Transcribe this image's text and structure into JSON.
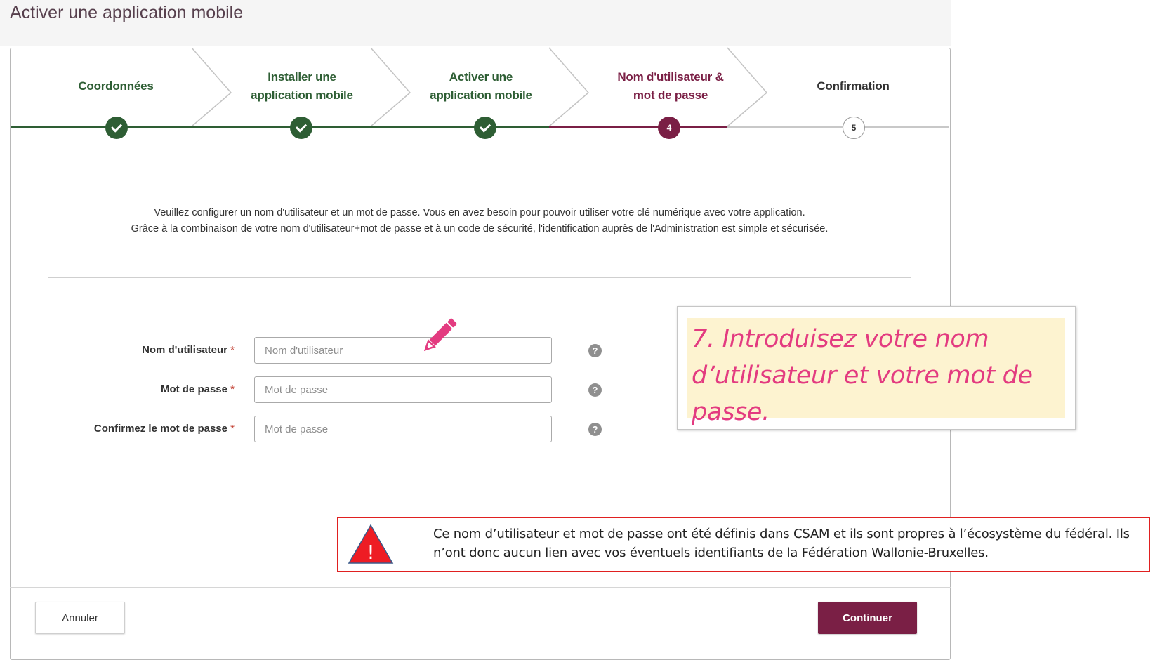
{
  "header": {
    "title": "Activer une application mobile"
  },
  "stepper": {
    "steps": [
      {
        "label_line1": "Coordonnées",
        "label_line2": "",
        "state": "done",
        "number": ""
      },
      {
        "label_line1": "Installer une",
        "label_line2": "application mobile",
        "state": "done",
        "number": ""
      },
      {
        "label_line1": "Activer une",
        "label_line2": "application mobile",
        "state": "done",
        "number": ""
      },
      {
        "label_line1": "Nom d'utilisateur &",
        "label_line2": "mot de passe",
        "state": "active",
        "number": "4"
      },
      {
        "label_line1": "Confirmation",
        "label_line2": "",
        "state": "todo",
        "number": "5"
      }
    ]
  },
  "intro": {
    "line1": "Veuillez configurer un nom d'utilisateur et un mot de passe. Vous en avez besoin pour pouvoir utiliser votre clé numérique avec votre application.",
    "line2": "Grâce à la combinaison de votre nom d'utilisateur+mot de passe et à un code de sécurité, l'identification auprès de l'Administration est simple et sécurisée."
  },
  "form": {
    "required_mark": "*",
    "help_symbol": "?",
    "fields": [
      {
        "label": "Nom d'utilisateur",
        "placeholder": "Nom d'utilisateur",
        "value": ""
      },
      {
        "label": "Mot de passe",
        "placeholder": "Mot de passe",
        "value": ""
      },
      {
        "label": "Confirmez le mot de passe",
        "placeholder": "Mot de passe",
        "value": ""
      }
    ]
  },
  "callout": {
    "text": "7. Introduisez votre nom d’utilisateur et votre mot de passe."
  },
  "warning": {
    "symbol": "!",
    "text": "Ce nom d’utilisateur et mot de passe ont été définis dans CSAM et ils sont propres à l’écosystème du fédéral. Ils n’ont donc aucun lien avec vos éventuels identifiants de la Fédération Wallonie-Bruxelles."
  },
  "footer": {
    "cancel_label": "Annuler",
    "continue_label": "Continuer"
  },
  "colors": {
    "done": "#2e5e34",
    "active": "#7a1f45",
    "todo_border": "#999999",
    "callout_text": "#e33b80",
    "callout_bg": "#fdf3d0",
    "warning_border": "#e02020",
    "pencil": "#e33b80"
  },
  "icons": {
    "done_step": "check-icon",
    "help": "help-icon",
    "annotation": "pencil-icon",
    "warning": "warning-triangle-icon"
  }
}
